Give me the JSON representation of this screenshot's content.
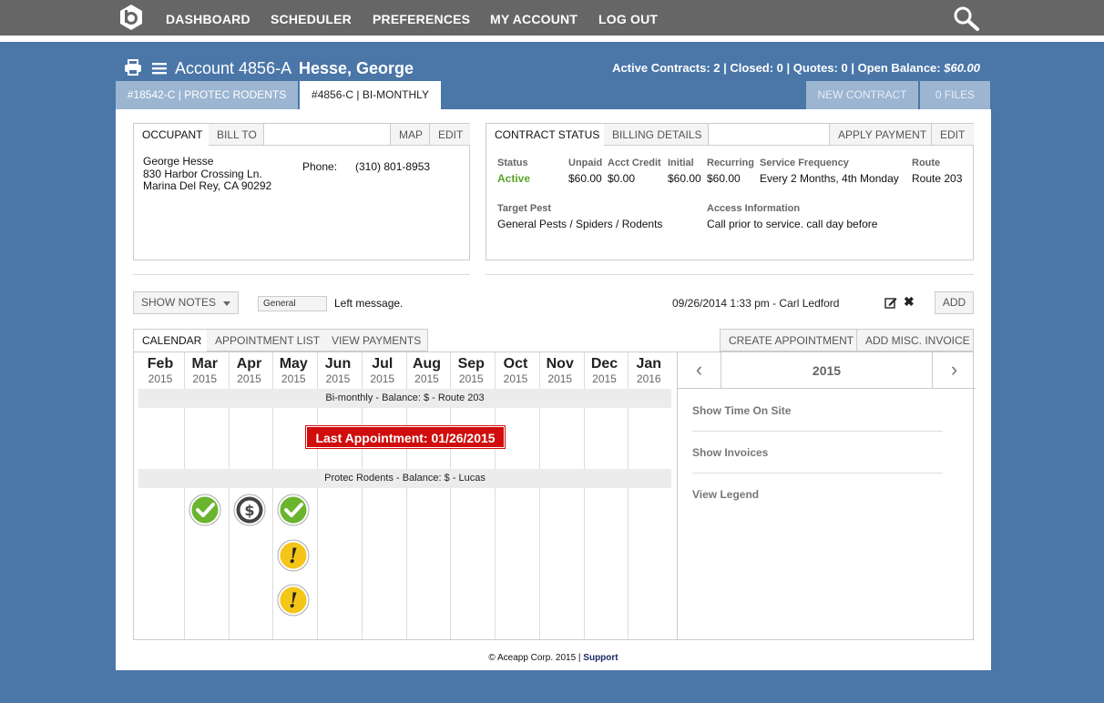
{
  "nav": {
    "items": [
      "DASHBOARD",
      "SCHEDULER",
      "PREFERENCES",
      "MY ACCOUNT",
      "LOG OUT"
    ]
  },
  "account": {
    "number": "Account 4856-A",
    "name": "Hesse, George",
    "summary": "Active Contracts: 2 | Closed: 0 | Quotes: 0 | Open Balance: ",
    "balance": "$60.00"
  },
  "contract_tabs": {
    "tab1": "#18542-C | PROTEC RODENTS",
    "tab2": "#4856-C | BI-MONTHLY",
    "new_contract": "NEW CONTRACT",
    "files": "0 FILES"
  },
  "occupant": {
    "tabs": [
      "OCCUPANT",
      "BILL TO"
    ],
    "map": "MAP",
    "edit": "EDIT",
    "name": "George Hesse",
    "street": "830 Harbor Crossing Ln.",
    "city": "Marina Del Rey, CA 90292",
    "phone_label": "Phone:",
    "phone": "(310) 801-8953"
  },
  "contract": {
    "tabs": [
      "CONTRACT STATUS",
      "BILLING DETAILS"
    ],
    "apply_payment": "APPLY PAYMENT",
    "edit": "EDIT",
    "status_label": "Status",
    "status": "Active",
    "unpaid_label": "Unpaid",
    "unpaid": "$60.00",
    "credit_label": "Acct Credit",
    "credit": "$0.00",
    "initial_label": "Initial",
    "initial": "$60.00",
    "recurring_label": "Recurring",
    "recurring": "$60.00",
    "freq_label": "Service Frequency",
    "freq": "Every 2 Months, 4th Monday",
    "route_label": "Route",
    "route": "Route 203",
    "pest_label": "Target Pest",
    "pest": "General Pests / Spiders / Rodents",
    "access_label": "Access Information",
    "access": "Call prior to service. call day before"
  },
  "notes": {
    "show_notes": "SHOW NOTES",
    "category": "General",
    "text": "Left message.",
    "meta": "09/26/2014 1:33 pm - Carl Ledford",
    "add": "ADD"
  },
  "calendar": {
    "tabs": [
      "CALENDAR",
      "APPOINTMENT LIST",
      "VIEW PAYMENTS"
    ],
    "create_appointment": "CREATE APPOINTMENT",
    "add_invoice": "ADD MISC. INVOICE",
    "months": [
      {
        "m": "Feb",
        "y": "2015"
      },
      {
        "m": "Mar",
        "y": "2015"
      },
      {
        "m": "Apr",
        "y": "2015"
      },
      {
        "m": "May",
        "y": "2015"
      },
      {
        "m": "Jun",
        "y": "2015"
      },
      {
        "m": "Jul",
        "y": "2015"
      },
      {
        "m": "Aug",
        "y": "2015"
      },
      {
        "m": "Sep",
        "y": "2015"
      },
      {
        "m": "Oct",
        "y": "2015"
      },
      {
        "m": "Nov",
        "y": "2015"
      },
      {
        "m": "Dec",
        "y": "2015"
      },
      {
        "m": "Jan",
        "y": "2016"
      }
    ],
    "band1": "Bi-monthly - Balance: $ - Route 203",
    "last_appointment": "Last Appointment: 01/26/2015",
    "band2": "Protec Rodents - Balance: $ - Lucas",
    "year": "2015",
    "side_links": [
      "Show Time On Site",
      "Show Invoices",
      "View Legend"
    ]
  },
  "footer": {
    "text": "© Aceapp Corp. 2015 | ",
    "support": "Support"
  },
  "colors": {
    "page_bg": "#4a76a8",
    "nav_bg": "#666666",
    "active_status": "#5aa52b",
    "alert_red": "#d00c0c",
    "check_green": "#6ab42e",
    "warning_yellow": "#f5c518"
  }
}
